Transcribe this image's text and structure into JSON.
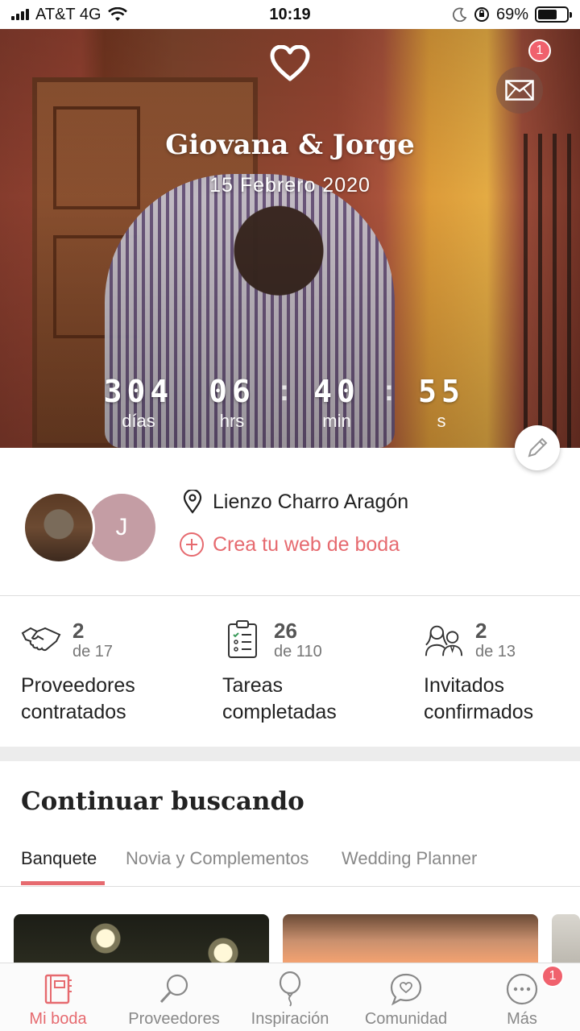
{
  "status_bar": {
    "carrier": "AT&T 4G",
    "time": "10:19",
    "battery": "69%",
    "battery_level": 0.69
  },
  "hero": {
    "couple_names": "Giovana & Jorge",
    "wedding_date": "15 Febrero 2020",
    "mail_badge": "1",
    "countdown": [
      {
        "value": "304",
        "label": "días"
      },
      {
        "value": "06",
        "label": "hrs"
      },
      {
        "value": "40",
        "label": "min"
      },
      {
        "value": "55",
        "label": "s"
      }
    ]
  },
  "info": {
    "avatar_initial": "J",
    "venue": "Lienzo Charro Aragón",
    "web_link": "Crea tu web de boda"
  },
  "stats": [
    {
      "count": "2",
      "total": "de 17",
      "label_line1": "Proveedores",
      "label_line2": "contratados",
      "icon": "handshake-icon"
    },
    {
      "count": "26",
      "total": "de 110",
      "label_line1": "Tareas",
      "label_line2": "completadas",
      "icon": "checklist-icon"
    },
    {
      "count": "2",
      "total": "de 13",
      "label_line1": "Invitados",
      "label_line2": "confirmados",
      "icon": "guests-icon"
    }
  ],
  "continue": {
    "title": "Continuar buscando",
    "tabs": [
      "Banquete",
      "Novia y Complementos",
      "Wedding Planner"
    ],
    "active_tab": "Banquete"
  },
  "bottom_nav": {
    "items": [
      {
        "label": "Mi boda",
        "icon": "notebook-icon",
        "active": true
      },
      {
        "label": "Proveedores",
        "icon": "search-icon",
        "active": false
      },
      {
        "label": "Inspiración",
        "icon": "balloon-icon",
        "active": false
      },
      {
        "label": "Comunidad",
        "icon": "chat-heart-icon",
        "active": false
      },
      {
        "label": "Más",
        "icon": "more-icon",
        "active": false
      }
    ],
    "more_badge": "1"
  },
  "colors": {
    "accent": "#e66a6f",
    "badge": "#f0616d",
    "avatar_bg": "#c49da4"
  }
}
